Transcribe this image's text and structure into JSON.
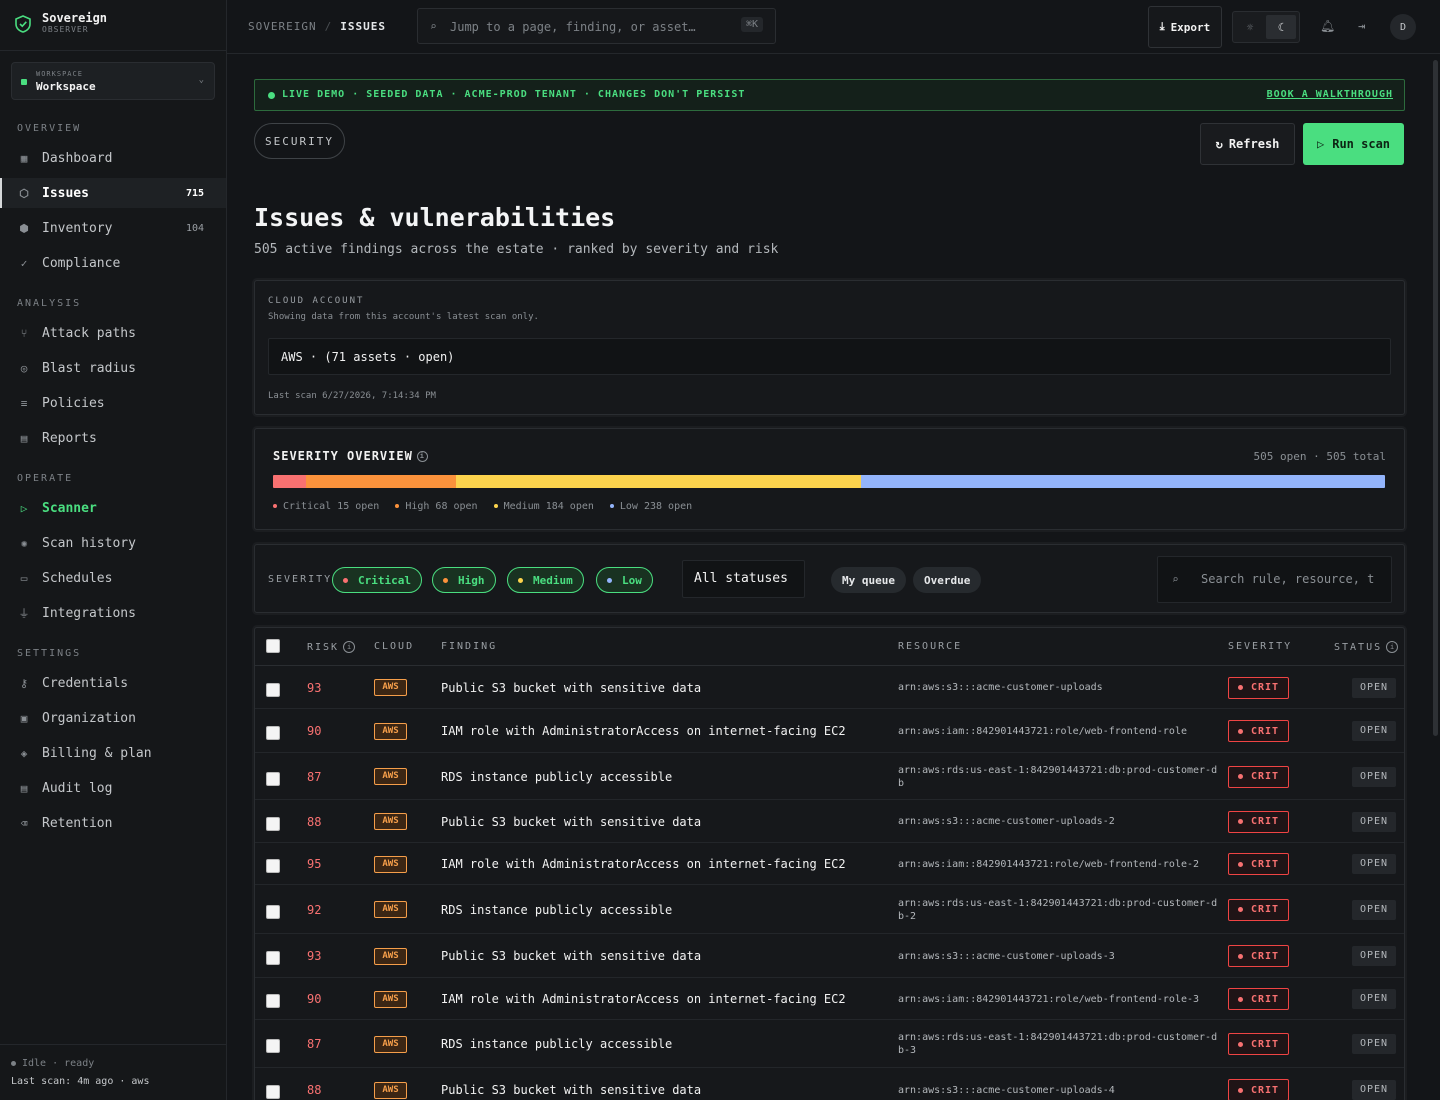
{
  "brand": {
    "name": "Sovereign",
    "sub": "OBSERVER",
    "logo_icon": "shield-check-icon",
    "accent": "#4ade80"
  },
  "workspace": {
    "label": "WORKSPACE",
    "value": "Workspace"
  },
  "sidebar": {
    "sections": [
      {
        "title": "OVERVIEW",
        "items": [
          {
            "label": "Dashboard",
            "icon": "grid-icon"
          },
          {
            "label": "Issues",
            "icon": "shield-icon",
            "badge": "715",
            "active": true
          },
          {
            "label": "Inventory",
            "icon": "box-icon",
            "badge": "104"
          },
          {
            "label": "Compliance",
            "icon": "check-icon"
          }
        ]
      },
      {
        "title": "ANALYSIS",
        "items": [
          {
            "label": "Attack paths",
            "icon": "branch-icon"
          },
          {
            "label": "Blast radius",
            "icon": "radar-icon"
          },
          {
            "label": "Policies",
            "icon": "list-icon"
          },
          {
            "label": "Reports",
            "icon": "file-icon"
          }
        ]
      },
      {
        "title": "OPERATE",
        "items": [
          {
            "label": "Scanner",
            "icon": "play-icon",
            "highlight": true
          },
          {
            "label": "Scan history",
            "icon": "sun-icon"
          },
          {
            "label": "Schedules",
            "icon": "calendar-icon"
          },
          {
            "label": "Integrations",
            "icon": "plug-icon"
          }
        ]
      },
      {
        "title": "SETTINGS",
        "items": [
          {
            "label": "Credentials",
            "icon": "key-icon"
          },
          {
            "label": "Organization",
            "icon": "building-icon"
          },
          {
            "label": "Billing & plan",
            "icon": "layers-icon"
          },
          {
            "label": "Audit log",
            "icon": "doc-icon"
          },
          {
            "label": "Retention",
            "icon": "trash-icon"
          }
        ]
      }
    ],
    "status": "Idle · ready",
    "last_scan": "Last scan: 4m ago · aws"
  },
  "topbar": {
    "crumb_root": "SOVEREIGN",
    "crumb_current": "ISSUES",
    "search_placeholder": "Jump to a page, finding, or asset…",
    "search_kbd": "⌘K",
    "export_label": "Export",
    "avatar": "D"
  },
  "banner": {
    "text": "LIVE DEMO · SEEDED DATA · ACME-PROD TENANT · CHANGES DON'T PERSIST",
    "link": "BOOK A WALKTHROUGH"
  },
  "header": {
    "pill": "SECURITY",
    "refresh_label": "Refresh",
    "run_label": "Run scan",
    "title": "Issues & vulnerabilities",
    "subtitle": "505 active findings across the estate · ranked by severity and risk"
  },
  "account": {
    "label": "CLOUD ACCOUNT",
    "desc": "Showing data from this account's latest scan only.",
    "value": "AWS · (71 assets · open)",
    "last_scan": "Last scan 6/27/2026, 7:14:34 PM"
  },
  "severity": {
    "title": "SEVERITY OVERVIEW",
    "counts": "505 open · 505 total",
    "segments": [
      {
        "name": "Critical",
        "value": 15,
        "color": "#f87171",
        "label": "Critical 15 open"
      },
      {
        "name": "High",
        "value": 68,
        "color": "#fb923c",
        "label": "High 68 open"
      },
      {
        "name": "Medium",
        "value": 184,
        "color": "#fcd34d",
        "label": "Medium 184 open"
      },
      {
        "name": "Low",
        "value": 238,
        "color": "#93b4fb",
        "label": "Low 238 open"
      }
    ]
  },
  "filters": {
    "label": "SEVERITY",
    "chips": [
      {
        "label": "Critical",
        "dot": "#f87171"
      },
      {
        "label": "High",
        "dot": "#fb923c"
      },
      {
        "label": "Medium",
        "dot": "#fcd34d"
      },
      {
        "label": "Low",
        "dot": "#93b4fb"
      }
    ],
    "status_value": "All statuses",
    "my_queue": "My queue",
    "overdue": "Overdue",
    "search_placeholder": "Search rule, resource, t"
  },
  "table": {
    "headers": {
      "risk": "RISK",
      "cloud": "CLOUD",
      "finding": "FINDING",
      "resource": "RESOURCE",
      "severity": "SEVERITY",
      "status": "STATUS"
    },
    "rows": [
      {
        "risk": "93",
        "cloud": "AWS",
        "finding": "Public S3 bucket with sensitive data",
        "resource": "arn:aws:s3:::acme-customer-uploads",
        "severity": "CRIT",
        "status": "OPEN"
      },
      {
        "risk": "90",
        "cloud": "AWS",
        "finding": "IAM role with AdministratorAccess on internet-facing EC2",
        "resource": "arn:aws:iam::842901443721:role/web-frontend-role",
        "severity": "CRIT",
        "status": "OPEN"
      },
      {
        "risk": "87",
        "cloud": "AWS",
        "finding": "RDS instance publicly accessible",
        "resource": "arn:aws:rds:us-east-1:842901443721:db:prod-customer-db",
        "severity": "CRIT",
        "status": "OPEN"
      },
      {
        "risk": "88",
        "cloud": "AWS",
        "finding": "Public S3 bucket with sensitive data",
        "resource": "arn:aws:s3:::acme-customer-uploads-2",
        "severity": "CRIT",
        "status": "OPEN"
      },
      {
        "risk": "95",
        "cloud": "AWS",
        "finding": "IAM role with AdministratorAccess on internet-facing EC2",
        "resource": "arn:aws:iam::842901443721:role/web-frontend-role-2",
        "severity": "CRIT",
        "status": "OPEN"
      },
      {
        "risk": "92",
        "cloud": "AWS",
        "finding": "RDS instance publicly accessible",
        "resource": "arn:aws:rds:us-east-1:842901443721:db:prod-customer-db-2",
        "severity": "CRIT",
        "status": "OPEN"
      },
      {
        "risk": "93",
        "cloud": "AWS",
        "finding": "Public S3 bucket with sensitive data",
        "resource": "arn:aws:s3:::acme-customer-uploads-3",
        "severity": "CRIT",
        "status": "OPEN"
      },
      {
        "risk": "90",
        "cloud": "AWS",
        "finding": "IAM role with AdministratorAccess on internet-facing EC2",
        "resource": "arn:aws:iam::842901443721:role/web-frontend-role-3",
        "severity": "CRIT",
        "status": "OPEN"
      },
      {
        "risk": "87",
        "cloud": "AWS",
        "finding": "RDS instance publicly accessible",
        "resource": "arn:aws:rds:us-east-1:842901443721:db:prod-customer-db-3",
        "severity": "CRIT",
        "status": "OPEN"
      },
      {
        "risk": "88",
        "cloud": "AWS",
        "finding": "Public S3 bucket with sensitive data",
        "resource": "arn:aws:s3:::acme-customer-uploads-4",
        "severity": "CRIT",
        "status": "OPEN"
      }
    ]
  }
}
